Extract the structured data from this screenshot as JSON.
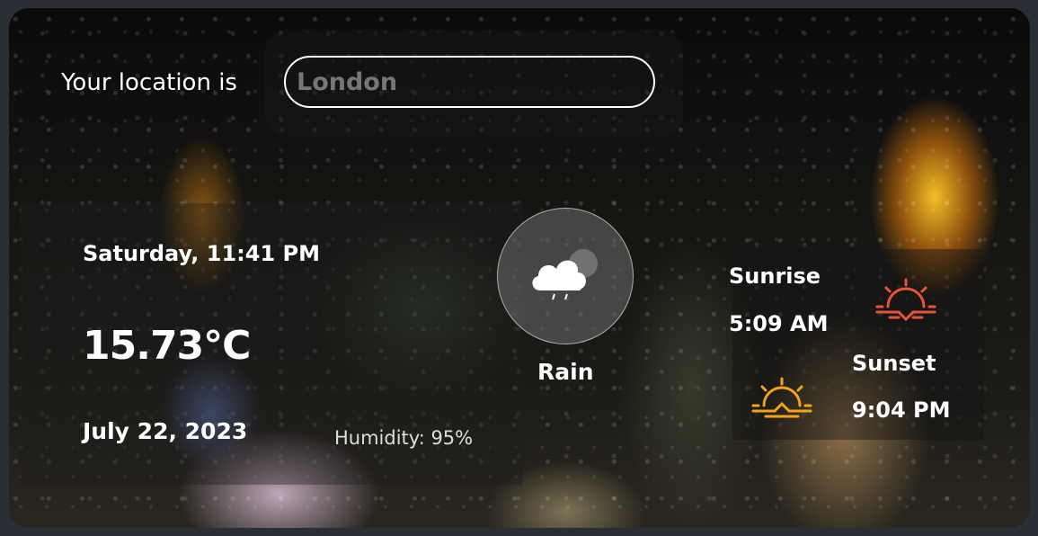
{
  "location": {
    "label": "Your location is",
    "input_placeholder": "London",
    "input_value": ""
  },
  "weather": {
    "day_time": "Saturday, 11:41 PM",
    "temperature": "15.73°C",
    "date": "July 22, 2023",
    "humidity": "Humidity: 95%",
    "condition": "Rain",
    "icon": "cloud-rain-icon"
  },
  "sun": {
    "sunrise_label": "Sunrise",
    "sunrise_time": "5:09 AM",
    "sunset_label": "Sunset",
    "sunset_time": "9:04 PM",
    "sunrise_color": "#e8533a",
    "sunset_color": "#f0a41c"
  }
}
